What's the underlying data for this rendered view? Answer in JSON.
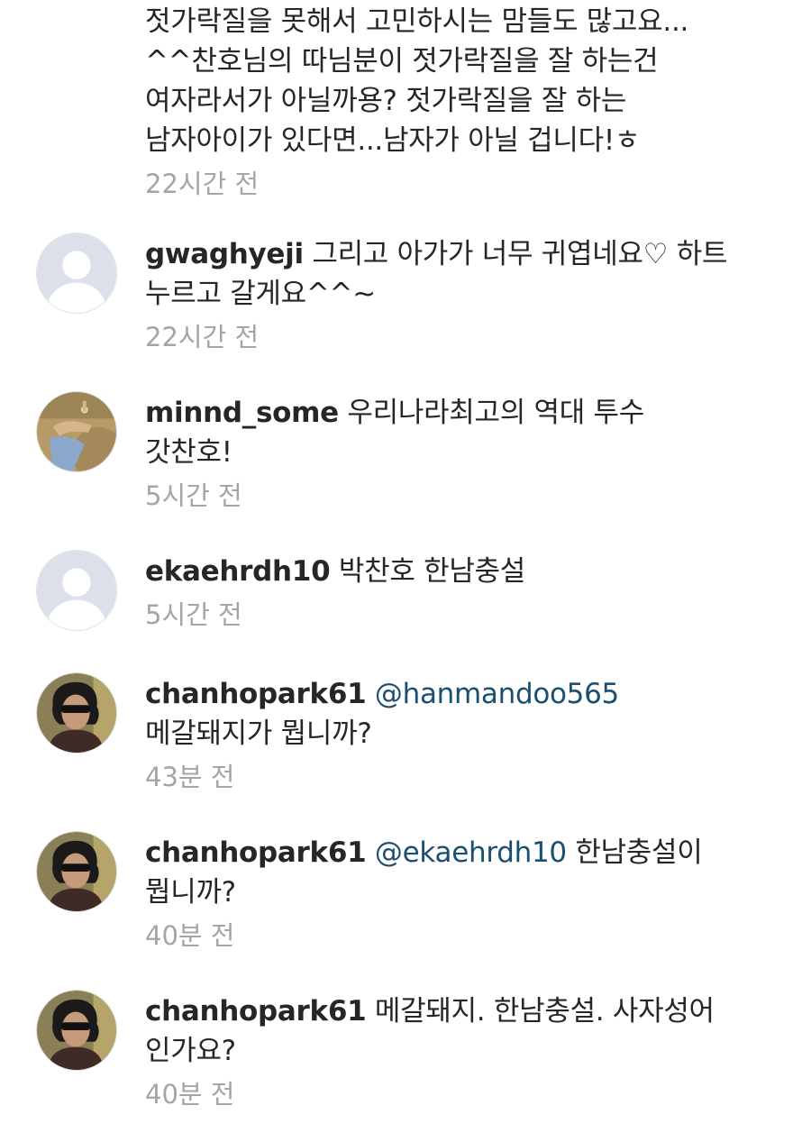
{
  "comments": [
    {
      "username": "",
      "mention": "",
      "text": "젓가락질을 못해서 고민하시는 맘들도 많고요...\n^^찬호님의 따님분이 젓가락질을 잘 하는건\n여자라서가 아닐까용? 젓가락질을 잘 하는\n남자아이가 있다면...남자가 아닐 겁니다!ㅎ",
      "time": "22시간 전",
      "avatar": "none"
    },
    {
      "username": "gwaghyeji",
      "mention": "",
      "text": "그리고 아가가 너무 귀엽네요♡ 하트\n누르고 갈게요^^~",
      "time": "22시간 전",
      "avatar": "default-profile-icon"
    },
    {
      "username": "minnd_some",
      "mention": "",
      "text": "우리나라최고의 역대 투수\n갓찬호!",
      "time": "5시간 전",
      "avatar": "photo-profile"
    },
    {
      "username": "ekaehrdh10",
      "mention": "",
      "text": "박찬호 한남충설",
      "time": "5시간 전",
      "avatar": "default-profile-icon"
    },
    {
      "username": "chanhopark61",
      "mention": "@hanmandoo565",
      "text": "\n메갈돼지가 뭡니까?",
      "time": "43분 전",
      "avatar": "photo-profile"
    },
    {
      "username": "chanhopark61",
      "mention": "@ekaehrdh10",
      "text": "한남충설이\n뭡니까?",
      "time": "40분 전",
      "avatar": "photo-profile"
    },
    {
      "username": "chanhopark61",
      "mention": "",
      "text": "메갈돼지. 한남충설. 사자성어\n인가요?",
      "time": "40분 전",
      "avatar": "photo-profile"
    }
  ]
}
